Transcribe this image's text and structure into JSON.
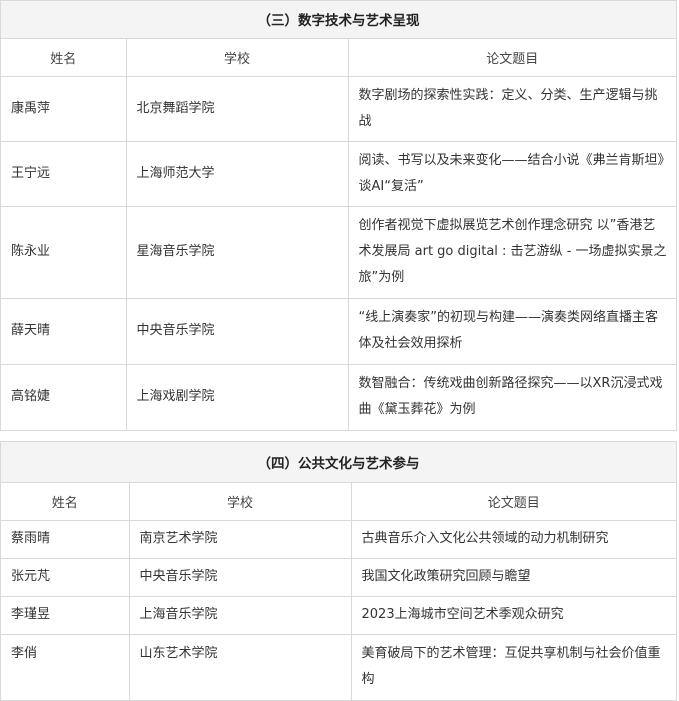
{
  "section3": {
    "title": "（三）数字技术与艺术呈现",
    "headers": [
      "姓名",
      "学校",
      "论文题目"
    ],
    "rows": [
      {
        "name": "康禹萍",
        "school": "北京舞蹈学院",
        "title": "数字剧场的探索性实践：定义、分类、生产逻辑与挑战"
      },
      {
        "name": "王宁远",
        "school": "上海师范大学",
        "title": "阅读、书写以及未来变化——结合小说《弗兰肯斯坦》谈AI“复活”"
      },
      {
        "name": "陈永业",
        "school": "星海音乐学院",
        "title": "创作者视觉下虚拟展览艺术创作理念研究 以”香港艺术发展局 art go digital : 击艺游纵 - 一场虚拟实景之旅”为例"
      },
      {
        "name": "薛天晴",
        "school": "中央音乐学院",
        "title": "“线上演奏家”的初现与构建——演奏类网络直播主客体及社会效用探析"
      },
      {
        "name": "高铭婕",
        "school": "上海戏剧学院",
        "title": "数智融合：传统戏曲创新路径探究——以XR沉浸式戏曲《黛玉葬花》为例"
      }
    ]
  },
  "section4": {
    "title": "（四）公共文化与艺术参与",
    "headers": [
      "姓名",
      "学校",
      "论文题目"
    ],
    "rows": [
      {
        "name": "蔡雨晴",
        "school": "南京艺术学院",
        "title": "古典音乐介入文化公共领域的动力机制研究"
      },
      {
        "name": "张元芃",
        "school": "中央音乐学院",
        "title": "我国文化政策研究回顾与瞻望"
      },
      {
        "name": "李瑾昱",
        "school": "上海音乐学院",
        "title": "2023上海城市空间艺术季观众研究"
      },
      {
        "name": "李俏",
        "school": "山东艺术学院",
        "title": "美育破局下的艺术管理：互促共享机制与社会价值重构"
      }
    ]
  }
}
